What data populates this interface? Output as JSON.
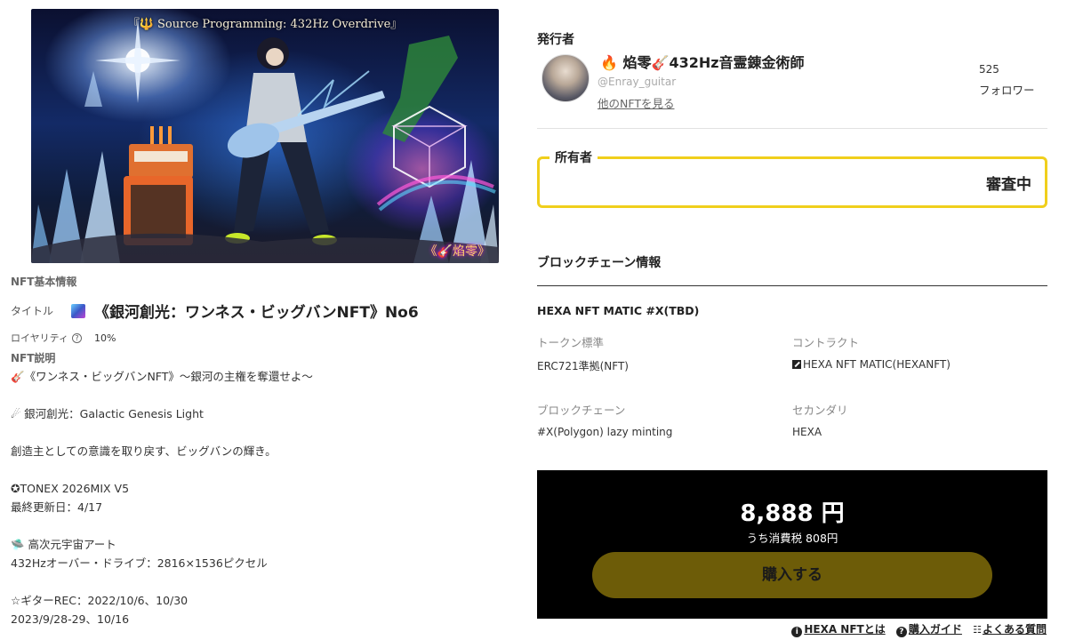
{
  "artwork": {
    "caption": "『🔱 Source Programming: 432Hz Overdrive』",
    "signature": "《🎸焰零》"
  },
  "nft_basic": {
    "heading": "NFT基本情報",
    "title_label": "タイトル",
    "title_icon": "galaxy-thumbnail-icon",
    "title": "《銀河創光：ワンネス・ビッグバンNFT》No6",
    "royalty_label": "ロイヤリティ",
    "royalty_value": "10%",
    "description_heading": "NFT説明",
    "description_lines": [
      "🎸《ワンネス・ビッグバンNFT》〜銀河の主権を奪還せよ〜",
      "",
      "☄ 銀河創光：Galactic Genesis Light",
      "",
      "創造主としての意識を取り戻す、ビッグバンの輝き。",
      "",
      "✪TONEX 2026MIX V5",
      "最終更新日：4/17",
      "",
      "🛸 高次元宇宙アート",
      "432Hzオーバー・ドライブ：2816×1536ピクセル",
      "",
      "☆ギターREC：2022/10/6、10/30",
      "2023/9/28-29、10/16"
    ]
  },
  "publisher": {
    "heading": "発行者",
    "name_fire": "🔥",
    "name_main": "焰零",
    "name_guitar": "🎸",
    "name_tail": "432Hz音霊錬金術師",
    "handle": "@Enray_guitar",
    "other_nft_link": "他のNFTを見る",
    "follower_count": "525",
    "follower_label": "フォロワー"
  },
  "owner": {
    "label": "所有者",
    "status": "審査中"
  },
  "blockchain": {
    "heading": "ブロックチェーン情報",
    "name": "HEXA NFT MATIC #X(TBD)",
    "token_standard_label": "トークン標準",
    "token_standard_value": "ERC721準拠(NFT)",
    "contract_label": "コントラクト",
    "contract_value": "HEXA NFT MATIC(HEXANFT)",
    "chain_label": "ブロックチェーン",
    "chain_value": "#X(Polygon) lazy minting",
    "secondary_label": "セカンダリ",
    "secondary_value": "HEXA"
  },
  "purchase": {
    "price": "8,888 円",
    "tax": "うち消費税 808円",
    "buy_label": "購入する"
  },
  "footer": {
    "about_hexa": "HEXA NFTとは",
    "purchase_guide": "購入ガイド",
    "faq": "よくある質問"
  },
  "colors": {
    "owner_border": "#f0cf1c",
    "buy_button": "#6d5c08",
    "purchase_panel": "#000000"
  }
}
